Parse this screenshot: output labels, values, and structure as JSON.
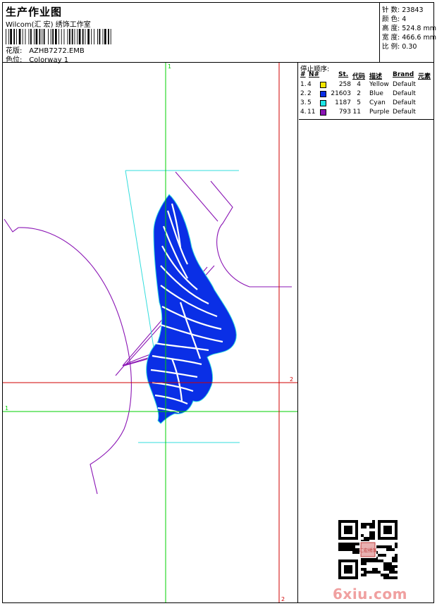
{
  "header": {
    "title": "生产作业图",
    "company": "Wilcom(汇 宏) 绣饰工作室",
    "pattern_label": "花版:",
    "pattern_value": "AZHB7272.EMB",
    "color_label": "色位:",
    "color_value": "Colorway 1"
  },
  "stats": [
    {
      "label": "针 数:",
      "value": "23843"
    },
    {
      "label": "颜 色:",
      "value": "4"
    },
    {
      "label": "高 度:",
      "value": "524.8 mm"
    },
    {
      "label": "宽 度:",
      "value": "466.6 mm"
    },
    {
      "label": "比 例:",
      "value": "0.30"
    }
  ],
  "stop_sequence": {
    "title": "停止顺序:",
    "columns": [
      "#",
      "N#",
      "St.",
      "代码",
      "描述",
      "Brand",
      "元素"
    ],
    "rows": [
      {
        "seq": "1.",
        "n": "4",
        "color": "#f5e600",
        "stitches": "258",
        "code": "4",
        "desc": "Yellow",
        "brand": "Default"
      },
      {
        "seq": "2.",
        "n": "2",
        "color": "#0a2fe6",
        "stitches": "21603",
        "code": "2",
        "desc": "Blue",
        "brand": "Default"
      },
      {
        "seq": "3.",
        "n": "5",
        "color": "#1ee6e6",
        "stitches": "1187",
        "code": "5",
        "desc": "Cyan",
        "brand": "Default"
      },
      {
        "seq": "4.",
        "n": "11",
        "color": "#8a14b4",
        "stitches": "793",
        "code": "11",
        "desc": "Purple",
        "brand": "Default"
      }
    ]
  },
  "canvas": {
    "marker_1": "1",
    "marker_2": "2",
    "colors": {
      "green": "#00d000",
      "red": "#d00000",
      "cyan": "#33dddd",
      "purple": "#8a14b4",
      "blue": "#0a2fe6"
    }
  },
  "watermark": {
    "text": "6xiu.com",
    "seal": "汇宏绣饰"
  }
}
